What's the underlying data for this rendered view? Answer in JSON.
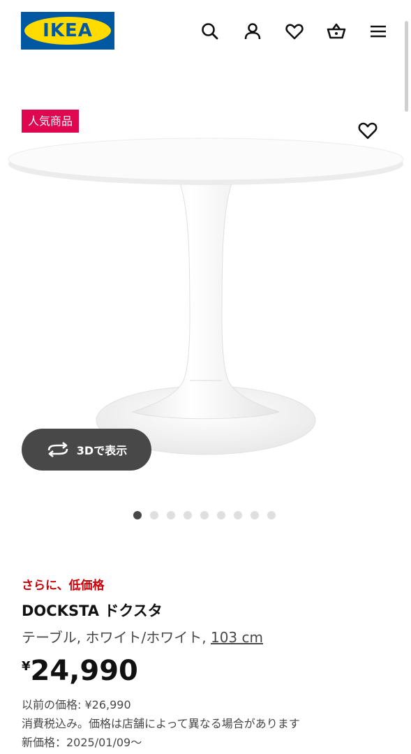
{
  "header": {
    "logo_text": "IKEA",
    "icons": [
      "search-icon",
      "user-icon",
      "heart-icon",
      "basket-icon",
      "menu-icon"
    ]
  },
  "gallery": {
    "badge": "人気商品",
    "view_3d_label": "3Dで表示",
    "total_images": 9,
    "active_index": 0
  },
  "product": {
    "lower_price_label": "さらに、低価格",
    "name": "DOCKSTA ドクスタ",
    "description": "テーブル, ホワイト/ホワイト, ",
    "dimension": "103 cm",
    "currency": "¥",
    "price": "24,990",
    "previous_price": "以前の価格: ¥26,990",
    "tax_note": "消費税込み。価格は店舗によって異なる場合があります",
    "new_price_date": "新価格：2025/01/09〜"
  },
  "colors": {
    "brand_blue": "#0058a3",
    "brand_yellow": "#ffdb00",
    "badge_bg": "#e00751",
    "lower_price_red": "#cc0008",
    "button_dark": "#484848"
  }
}
